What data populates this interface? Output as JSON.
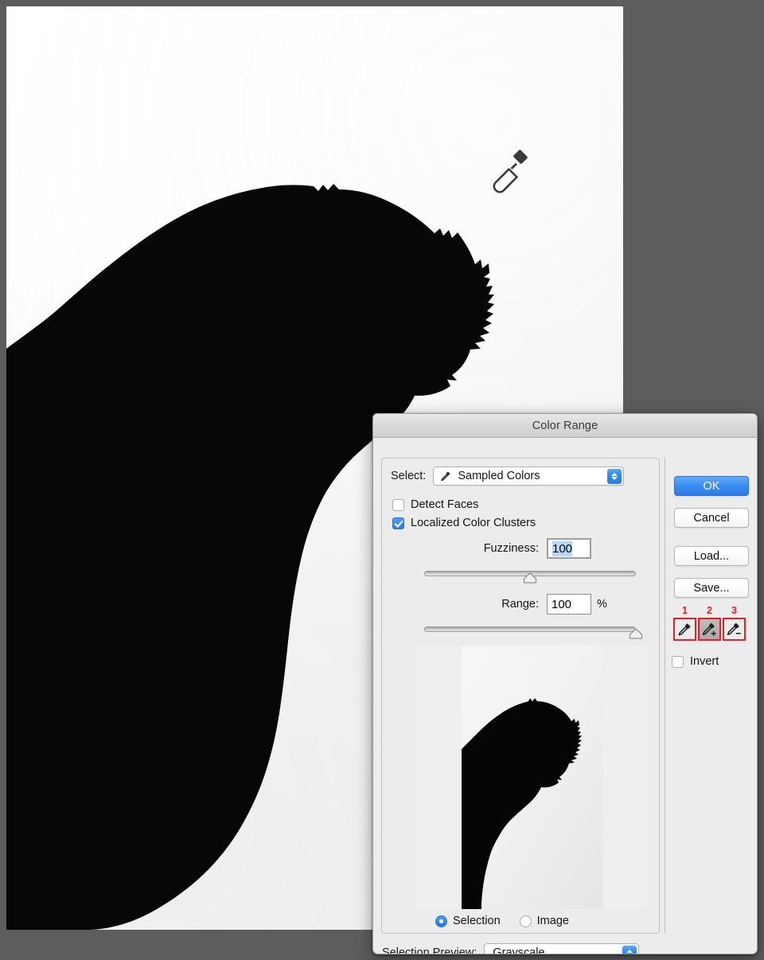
{
  "window": {
    "background_color": "#5d5d5d"
  },
  "canvas": {
    "name": "photoshop-canvas",
    "cursor_icon": "eyedropper-cursor",
    "subject_description": "black silhouette of a person bowing head"
  },
  "dialog": {
    "title": "Color Range",
    "select": {
      "label": "Select:",
      "value": "Sampled Colors",
      "icon": "eyedropper-icon"
    },
    "checkboxes": [
      {
        "label": "Detect Faces",
        "checked": false
      },
      {
        "label": "Localized Color Clusters",
        "checked": true
      }
    ],
    "fuzziness": {
      "label": "Fuzziness:",
      "value": "100",
      "slider_percent": 50
    },
    "range": {
      "label": "Range:",
      "value": "100",
      "unit": "%",
      "slider_percent": 100
    },
    "preview_mode": {
      "options": [
        {
          "label": "Selection",
          "selected": true
        },
        {
          "label": "Image",
          "selected": false
        }
      ]
    },
    "selection_preview": {
      "label": "Selection Preview:",
      "value": "Grayscale"
    },
    "buttons": {
      "ok": "OK",
      "cancel": "Cancel",
      "load": "Load...",
      "save": "Save..."
    },
    "eyedroppers": [
      {
        "number": "1",
        "icon": "eyedropper-icon",
        "pressed": false,
        "annotated": true
      },
      {
        "number": "2",
        "icon": "eyedropper-plus-icon",
        "pressed": true,
        "annotated": true
      },
      {
        "number": "3",
        "icon": "eyedropper-minus-icon",
        "pressed": false,
        "annotated": true
      }
    ],
    "invert": {
      "label": "Invert",
      "checked": false
    },
    "annotation_color": "#ec1c24",
    "accent_color": "#2a7bea"
  }
}
